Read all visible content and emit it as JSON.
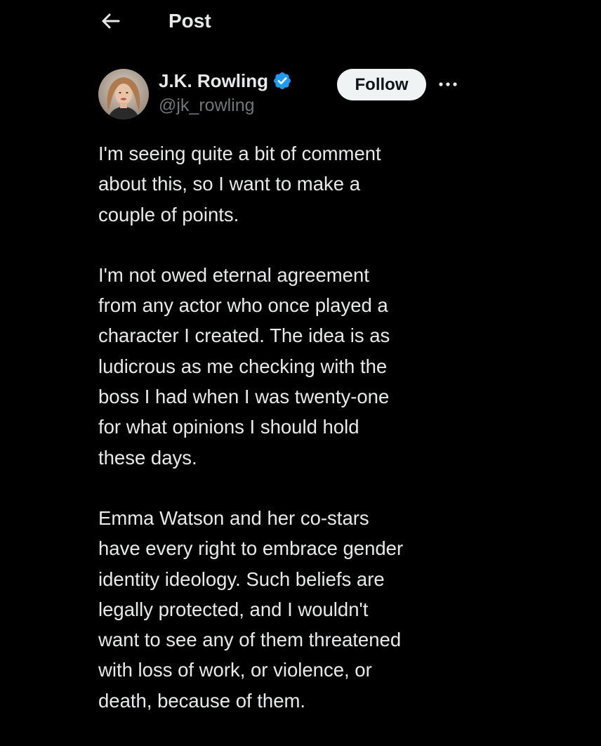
{
  "header": {
    "back_icon": "arrow-left-icon",
    "title": "Post"
  },
  "author": {
    "display_name": "J.K. Rowling",
    "handle": "@jk_rowling",
    "verified_icon": "verified-badge-icon",
    "verified_color": "#1d9bf0",
    "follow_label": "Follow",
    "more_icon": "more-horizontal-icon"
  },
  "post": {
    "paragraphs": [
      {
        "lines": [
          "I'm seeing quite a bit of comment",
          "about this, so I want to make a",
          "couple of points."
        ]
      },
      {
        "lines": [
          "I'm not owed eternal agreement",
          "from any actor who once played a",
          "character I created. The idea is as",
          "ludicrous as me checking with the",
          "boss I had when I was twenty-one",
          "for what opinions I should hold",
          "these days."
        ]
      },
      {
        "lines": [
          "Emma Watson and her co-stars",
          "have every right to embrace gender",
          "identity ideology. Such beliefs are",
          "legally protected, and I wouldn't",
          "want to see any of them threatened",
          "with loss of work, or violence, or",
          "death, because of them."
        ]
      }
    ]
  },
  "colors": {
    "background": "#000000",
    "text_primary": "#e7e9ea",
    "text_secondary": "#71767b",
    "follow_bg": "#eff3f4",
    "follow_text": "#0f1419"
  }
}
